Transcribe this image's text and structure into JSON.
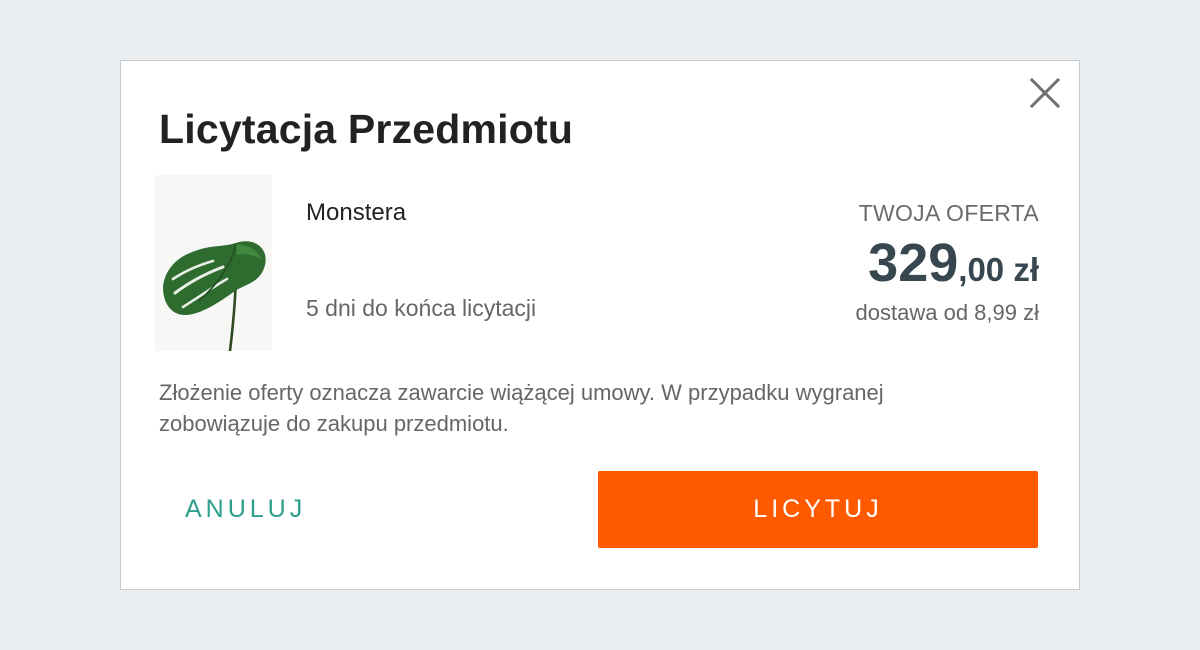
{
  "dialog": {
    "title": "Licytacja Przedmiotu",
    "close_icon": "close-icon"
  },
  "product": {
    "name": "Monstera",
    "image_icon": "monstera-leaf-image",
    "time_left": "5 dni do końca licytacji"
  },
  "offer": {
    "label": "TWOJA OFERTA",
    "price_integer": "329",
    "price_decimal": ",00 zł",
    "delivery": "dostawa od 8,99 zł"
  },
  "legal_text": "Złożenie oferty oznacza zawarcie wiążącej umowy. W przypadku wygranej zobowiązuje do zakupu przedmiotu.",
  "actions": {
    "cancel_label": "ANULUJ",
    "bid_label": "LICYTUJ"
  },
  "colors": {
    "accent": "#ff5a00",
    "cancel": "#2d9f8c",
    "price": "#37474f",
    "background": "#ebeef1"
  }
}
